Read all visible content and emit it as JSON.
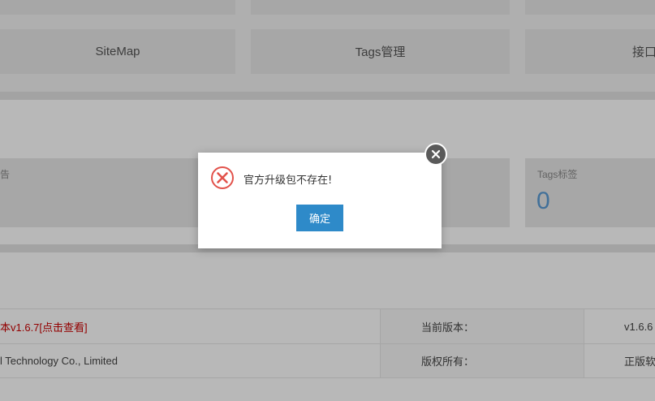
{
  "quick_links": {
    "sitemap_label": "SiteMap",
    "tags_label": "Tags管理",
    "api_label": "接口"
  },
  "stats": {
    "left_label": "告",
    "tags_label": "Tags标签",
    "tags_value": "0"
  },
  "system_info": {
    "rows": [
      {
        "left_value": "本v1.6.7[点击查看]",
        "middle_label": "当前版本：",
        "right_value": "v1.6.6"
      },
      {
        "left_value": "l Technology Co., Limited",
        "middle_label": "版权所有：",
        "right_value": "正版软"
      }
    ]
  },
  "dialog": {
    "message": "官方升级包不存在!",
    "confirm_label": "确定",
    "icon": "error-circle-icon",
    "close_icon": "close-icon"
  },
  "colors": {
    "update_link": "#cc0000",
    "accent": "#2e8ac9",
    "error_icon": "#e2524b"
  }
}
